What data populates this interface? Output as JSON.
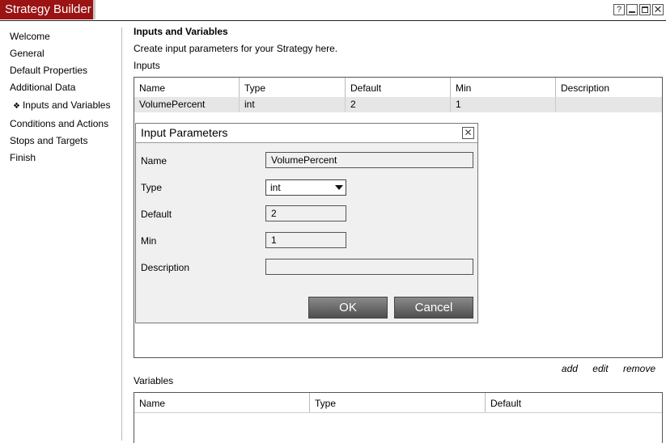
{
  "window": {
    "title": "Strategy Builder",
    "help_glyph": "?",
    "close_glyph": "✕"
  },
  "sidebar": {
    "items": [
      {
        "label": "Welcome"
      },
      {
        "label": "General"
      },
      {
        "label": "Default Properties"
      },
      {
        "label": "Additional Data"
      },
      {
        "label": "Inputs and Variables",
        "selected": true,
        "bullet": "❖"
      },
      {
        "label": "Conditions and Actions"
      },
      {
        "label": "Stops and Targets"
      },
      {
        "label": "Finish"
      }
    ]
  },
  "main": {
    "title": "Inputs and Variables",
    "description": "Create input parameters for your Strategy here.",
    "inputs_label": "Inputs",
    "inputs_table": {
      "columns": [
        "Name",
        "Type",
        "Default",
        "Min",
        "Description"
      ],
      "rows": [
        [
          "VolumePercent",
          "int",
          "2",
          "1",
          ""
        ]
      ]
    },
    "actions": {
      "add": "add",
      "edit": "edit",
      "remove": "remove"
    },
    "variables_label": "Variables",
    "variables_table": {
      "columns": [
        "Name",
        "Type",
        "Default"
      ],
      "rows": []
    }
  },
  "dialog": {
    "title": "Input Parameters",
    "close_glyph": "✕",
    "labels": {
      "name": "Name",
      "type": "Type",
      "default": "Default",
      "min": "Min",
      "description": "Description"
    },
    "values": {
      "name": "VolumePercent",
      "type": "int",
      "default": "2",
      "min": "1",
      "description": ""
    },
    "ok": "OK",
    "cancel": "Cancel"
  },
  "colors": {
    "title_tab": "#9b1313",
    "button_top": "#8a8a8a",
    "button_bottom": "#4f4f4f"
  }
}
